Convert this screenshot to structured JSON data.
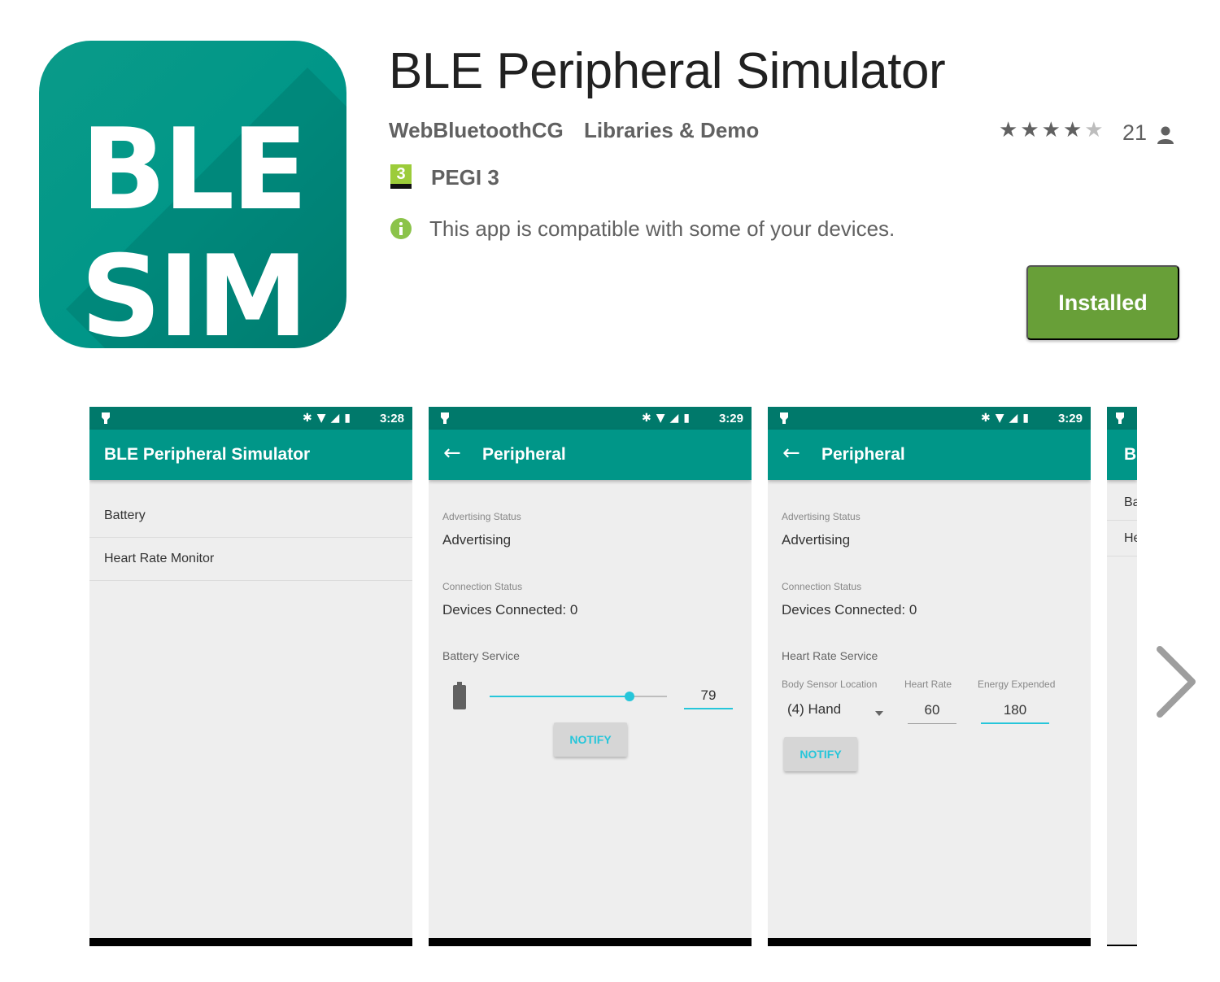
{
  "app": {
    "icon_text_line1": "BLE",
    "icon_text_line2": "SIM",
    "title": "BLE Peripheral Simulator",
    "developer": "WebBluetoothCG",
    "category": "Libraries & Demo",
    "rating_stars": 4.5,
    "rating_count": "21",
    "pegi_number": "3",
    "pegi_label": "PEGI 3",
    "compatibility": "This app is compatible with some of your devices.",
    "install_button": "Installed",
    "brand_color": "#009688",
    "install_color": "#689f38"
  },
  "screenshots": {
    "shot1": {
      "time": "3:28",
      "title": "BLE Peripheral Simulator",
      "items": [
        "Battery",
        "Heart Rate Monitor"
      ]
    },
    "shot2": {
      "time": "3:29",
      "title": "Peripheral",
      "adv_caption": "Advertising Status",
      "adv_value": "Advertising",
      "conn_caption": "Connection Status",
      "conn_value": "Devices Connected: 0",
      "service": "Battery Service",
      "battery_level": "79",
      "slider_fraction": 0.79,
      "notify": "NOTIFY"
    },
    "shot3": {
      "time": "3:29",
      "title": "Peripheral",
      "adv_caption": "Advertising Status",
      "adv_value": "Advertising",
      "conn_caption": "Connection Status",
      "conn_value": "Devices Connected: 0",
      "service": "Heart Rate Service",
      "col1": "Body Sensor Location",
      "col2": "Heart Rate",
      "col3": "Energy Expended",
      "location": "(4) Hand",
      "heart_rate": "60",
      "energy": "180",
      "notify": "NOTIFY"
    },
    "shot4": {
      "title_partial": "BI",
      "item1_partial": "Ba",
      "item2_partial": "He"
    }
  }
}
